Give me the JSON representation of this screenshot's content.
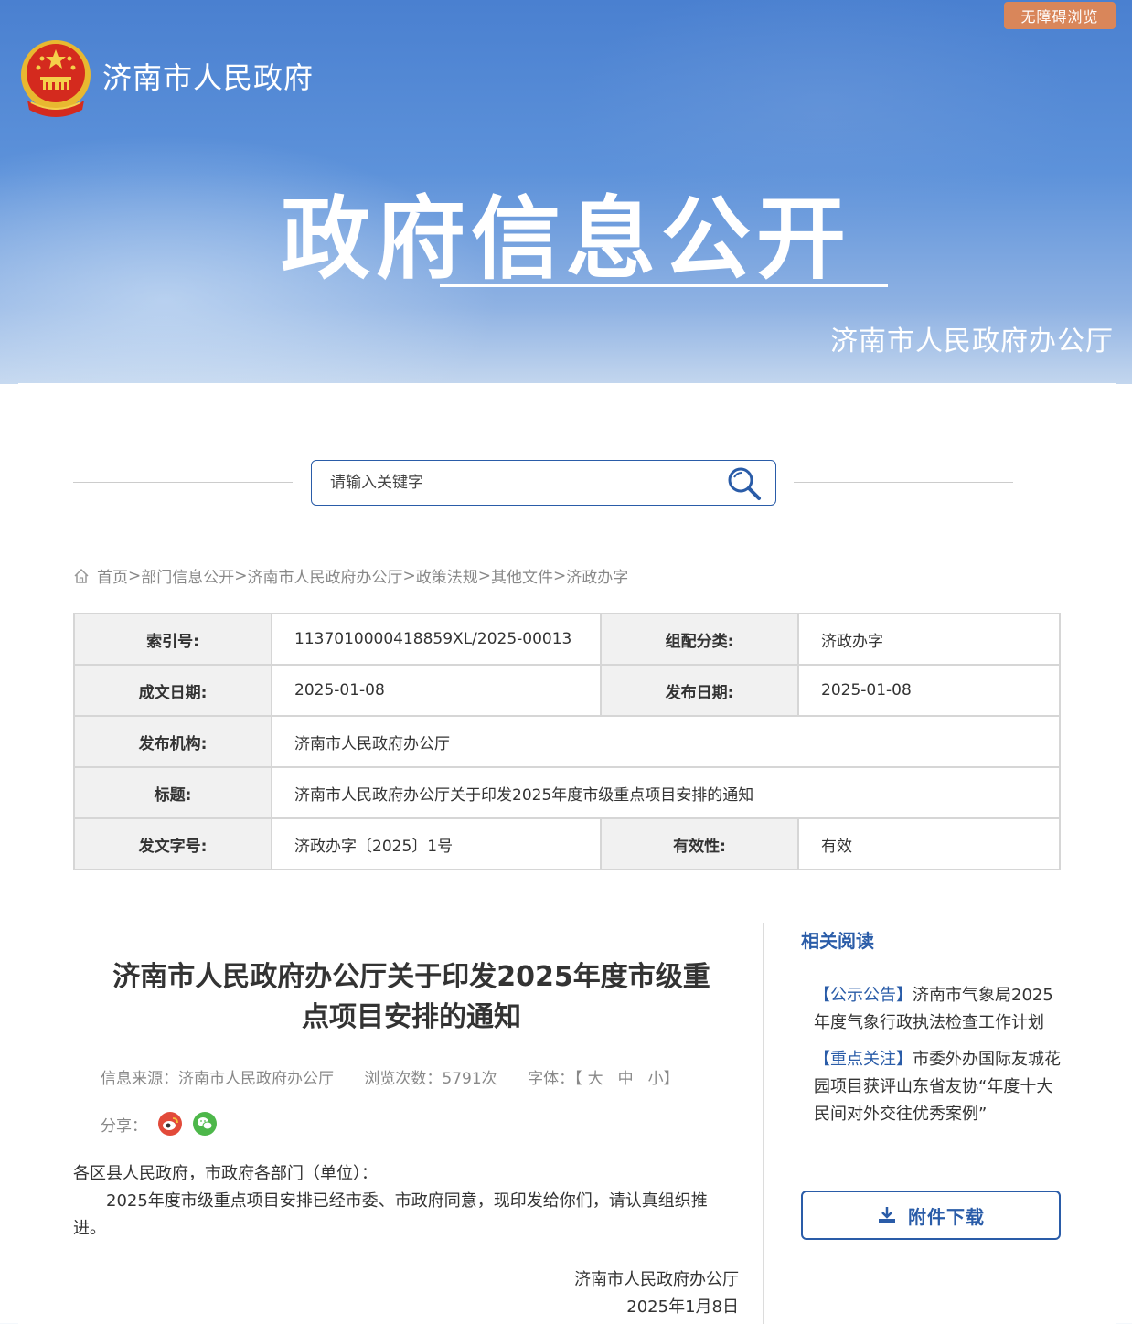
{
  "header": {
    "accessibility_label": "无障碍浏览",
    "site_title": "济南市人民政府",
    "hero_title": "政府信息公开",
    "hero_subtitle": "济南市人民政府办公厅"
  },
  "search": {
    "placeholder": "请输入关键字"
  },
  "breadcrumb": {
    "items": [
      "首页",
      "部门信息公开",
      "济南市人民政府办公厅",
      "政策法规",
      "其他文件",
      "济政办字"
    ],
    "separator": ">"
  },
  "info": {
    "index_label": "索引号:",
    "index_value": "113701000041885​9XL/2025-00013",
    "category_label": "组配分类:",
    "category_value": "济政办字",
    "written_label": "成文日期:",
    "written_value": "2025-01-08",
    "published_label": "发布日期:",
    "published_value": "2025-01-08",
    "org_label": "发布机构:",
    "org_value": "济南市人民政府办公厅",
    "title_label": "标题:",
    "title_value": "济南市人民政府办公厅关于印发2025年度市级重点项目安排的通知",
    "docno_label": "发文字号:",
    "docno_value": "济政办字〔2025〕1号",
    "validity_label": "有效性:",
    "validity_value": "有效"
  },
  "article": {
    "title_line1": "济南市人民政府办公厅关于印发2025年度市级重",
    "title_line2": "点项目安排的通知",
    "source": "信息来源：济南市人民政府办公厅",
    "views": "浏览次数：5791次",
    "font_label": "字体：",
    "font_open": "【",
    "font_large": "大",
    "font_medium": "中",
    "font_small": "小",
    "font_close": "】",
    "share_label": "分享：",
    "salutation": "各区县人民政府，市政府各部门（单位）：",
    "paragraph": "2025年度市级重点项目安排已经市委、市政府同意，现印发给你们，请认真组织推进。",
    "signer": "济南市人民政府办公厅",
    "date": "2025年1月8日"
  },
  "sidebar": {
    "heading": "相关阅读",
    "items": [
      {
        "tag": "【公示公告】",
        "text": "济南市气象局2025年度气象行政执法检查工作计划"
      },
      {
        "tag": "【重点关注】",
        "text": "市委外办国际友城花园项目获评山东省友协“年度十大民间对外交往优秀案例”"
      }
    ],
    "download_label": "附件下载"
  },
  "colors": {
    "accent": "#2a5ca8",
    "access_btn": "#d9865a",
    "banner": "#5d92da"
  }
}
